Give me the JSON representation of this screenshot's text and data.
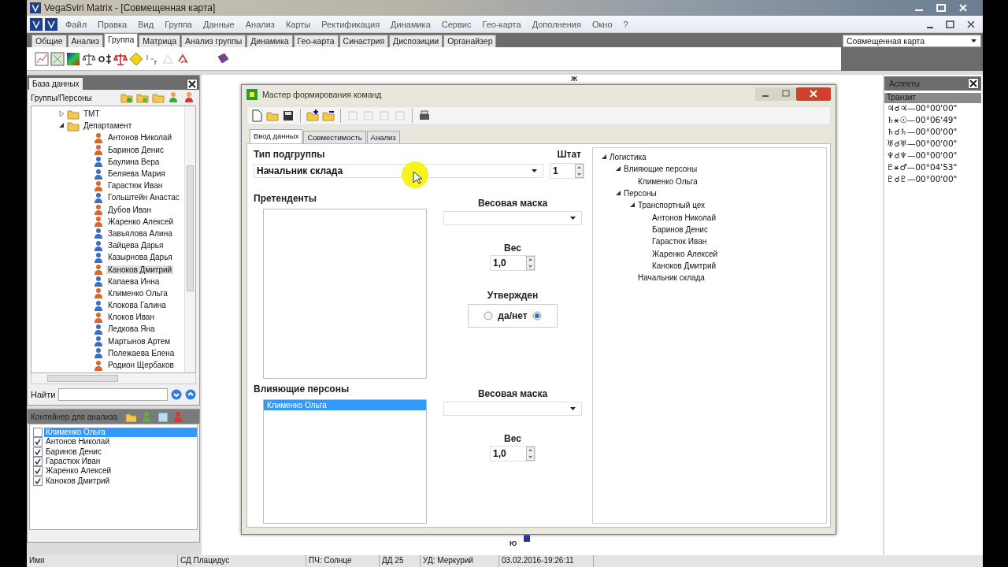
{
  "window": {
    "title": "VegaSviri Matrix - [Совмещенная карта]"
  },
  "menu": [
    "Файл",
    "Правка",
    "Вид",
    "Группа",
    "Данные",
    "Анализ",
    "Карты",
    "Ректификация",
    "Динамика",
    "Сервис",
    "Гео-карта",
    "Дополнения",
    "Окно",
    "?"
  ],
  "ribbon_tabs": [
    {
      "label": "Общие",
      "selected": false
    },
    {
      "label": "Анализ",
      "selected": false
    },
    {
      "label": "Группа",
      "selected": true
    },
    {
      "label": "Матрица",
      "selected": false
    },
    {
      "label": "Анализ группы",
      "selected": false
    },
    {
      "label": "Динамика",
      "selected": false
    },
    {
      "label": "Гео-карта",
      "selected": false
    },
    {
      "label": "Синастрия",
      "selected": false
    },
    {
      "label": "Диспозиции",
      "selected": false
    },
    {
      "label": "Органайзер",
      "selected": false
    }
  ],
  "map_selector": {
    "value": "Совмещенная карта"
  },
  "database_panel": {
    "title": "База данных",
    "subtitle": "Группы/Персоны",
    "search_label": "Найти",
    "tree": [
      {
        "label": "ТМТ",
        "expanded": false
      },
      {
        "label": "Департамент",
        "expanded": true,
        "children": [
          {
            "label": "Антонов Николай",
            "color": "#d9662b",
            "selected": false
          },
          {
            "label": "Баринов Денис",
            "color": "#d9662b",
            "selected": false
          },
          {
            "label": "Баулина Вера",
            "color": "#3a6fc4",
            "selected": false
          },
          {
            "label": "Беляева Мария",
            "color": "#3a6fc4",
            "selected": false
          },
          {
            "label": "Гарастюк Иван",
            "color": "#d9662b",
            "selected": false
          },
          {
            "label": "Гольштейн Анастас",
            "color": "#3a6fc4",
            "selected": false
          },
          {
            "label": "Дубов Иван",
            "color": "#d9662b",
            "selected": false
          },
          {
            "label": "Жаренко Алексей",
            "color": "#d9662b",
            "selected": false
          },
          {
            "label": "Завьялова Алина",
            "color": "#3a6fc4",
            "selected": false
          },
          {
            "label": "Зайцева Дарья",
            "color": "#3a6fc4",
            "selected": false
          },
          {
            "label": "Казырнова Дарья",
            "color": "#3a6fc4",
            "selected": false
          },
          {
            "label": "Каноков Дмитрий",
            "color": "#d9662b",
            "selected": true
          },
          {
            "label": "Капаева Инна",
            "color": "#3a6fc4",
            "selected": false
          },
          {
            "label": "Клименко Ольга",
            "color": "#d9662b",
            "selected": false
          },
          {
            "label": "Клокова Галина",
            "color": "#3a6fc4",
            "selected": false
          },
          {
            "label": "Клоков Иван",
            "color": "#d9662b",
            "selected": false
          },
          {
            "label": "Ледкова Яна",
            "color": "#3a6fc4",
            "selected": false
          },
          {
            "label": "Мартынов Артем",
            "color": "#3a6fc4",
            "selected": false
          },
          {
            "label": "Полежаева Елена",
            "color": "#3a6fc4",
            "selected": false
          },
          {
            "label": "Родион Щербаков",
            "color": "#d9662b",
            "selected": false
          }
        ]
      }
    ]
  },
  "container_panel": {
    "title": "Контейнер для анализа",
    "items": [
      {
        "label": "Клименко Ольга",
        "checked": false,
        "selected": true
      },
      {
        "label": "Антонов Николай",
        "checked": true,
        "selected": false
      },
      {
        "label": "Баринов Денис",
        "checked": true,
        "selected": false
      },
      {
        "label": "Гарастюк Иван",
        "checked": true,
        "selected": false
      },
      {
        "label": "Жаренко Алексей",
        "checked": true,
        "selected": false
      },
      {
        "label": "Каноков Дмитрий",
        "checked": true,
        "selected": false
      }
    ]
  },
  "canvas_labels": [
    "Ж",
    "Ю"
  ],
  "dialog": {
    "title": "Мастер формирования команд",
    "tabs": [
      {
        "label": "Ввод данных",
        "selected": true
      },
      {
        "label": "Совместимость",
        "selected": false
      },
      {
        "label": "Анализ",
        "selected": false
      }
    ],
    "subgroup_type": {
      "label": "Тип подгруппы",
      "value": "Начальник склада"
    },
    "staff": {
      "label": "Штат",
      "value": "1"
    },
    "candidates": {
      "label": "Претенденты"
    },
    "candidates_weights": {
      "mask_label": "Весовая маска",
      "weight_label": "Вес",
      "weight": "1,0"
    },
    "approved": {
      "label": "Утвержден",
      "option": "да/нет",
      "radios": [
        {
          "selected": false
        },
        {
          "selected": true
        }
      ]
    },
    "influencers": {
      "label": "Влияющие персоны",
      "items": [
        {
          "label": "Клименко Ольга",
          "selected": true
        }
      ]
    },
    "influencers_weights": {
      "mask_label": "Весовая маска",
      "weight_label": "Вес",
      "weight": "1,0"
    },
    "tree": [
      {
        "label": "Логистика",
        "expanded": true,
        "children": [
          {
            "label": "Влияющие персоны",
            "expanded": true,
            "children": [
              {
                "label": "Клименко Ольга"
              }
            ]
          },
          {
            "label": "Персоны",
            "expanded": true,
            "children": [
              {
                "label": "Транспортный цех",
                "expanded": true,
                "children": [
                  {
                    "label": "Антонов Николай"
                  },
                  {
                    "label": "Баринов Денис"
                  },
                  {
                    "label": "Гарастюк Иван"
                  },
                  {
                    "label": "Жаренко Алексей"
                  },
                  {
                    "label": "Каноков Дмитрий"
                  }
                ]
              },
              {
                "label": "Начальник склада"
              }
            ]
          }
        ]
      }
    ]
  },
  "aspects_panel": {
    "title": "Аспекты",
    "section": "Транзит",
    "rows": [
      "♃☌♃—00°00'00\"",
      "♄⚹☉—00°06'49\"",
      "♄☌♄—00°00'00\"",
      "♅☌♅—00°00'00\"",
      "♆☌♆—00°00'00\"",
      "♇⚹♂—00°04'53\"",
      "♇☌♇—00°00'00\""
    ]
  },
  "status_bar": [
    "Имя",
    "СД Плацидус",
    "ПЧ: Солнце",
    "ДД 25",
    "УД: Меркурий",
    "03.02.2016-19:26:11"
  ]
}
